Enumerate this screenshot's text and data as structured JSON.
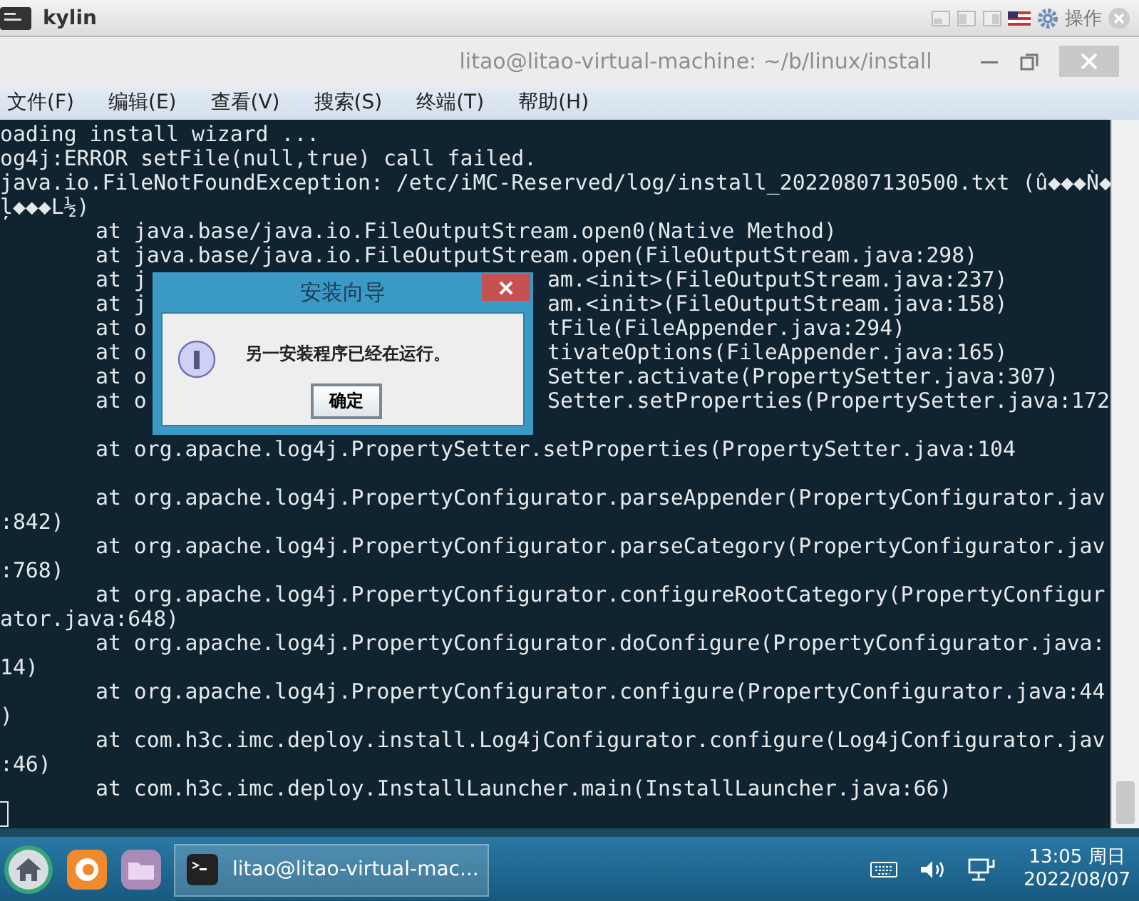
{
  "host_window": {
    "title": "kylin",
    "action_label": "操作"
  },
  "terminal": {
    "title": "litao@litao-virtual-machine: ~/b/linux/install",
    "menu": [
      "文件(F)",
      "编辑(E)",
      "查看(V)",
      "搜索(S)",
      "终端(T)",
      "帮助(H)"
    ],
    "lines": [
      {
        "kind": "plain",
        "text": "oading install wizard ..."
      },
      {
        "kind": "plain",
        "text": "og4j:ERROR setFile(null,true) call failed."
      },
      {
        "kind": "plain",
        "text": "java.io.FileNotFoundException: /etc/iMC-Reserved/log/install_20220807130500.txt (û◆◆◆Ǹ◆"
      },
      {
        "kind": "plain",
        "text": "ļ◆◆◆L½)"
      },
      {
        "kind": "at",
        "text": "at java.base/java.io.FileOutputStream.open0(Native Method)"
      },
      {
        "kind": "at",
        "text": "at java.base/java.io.FileOutputStream.open(FileOutputStream.java:298)"
      },
      {
        "kind": "split",
        "left": "at j",
        "right": "am.<init>(FileOutputStream.java:237)"
      },
      {
        "kind": "split",
        "left": "at j",
        "right": "am.<init>(FileOutputStream.java:158)"
      },
      {
        "kind": "split",
        "left": "at o",
        "right": "tFile(FileAppender.java:294)"
      },
      {
        "kind": "split",
        "left": "at o",
        "right": "tivateOptions(FileAppender.java:165)"
      },
      {
        "kind": "split",
        "left": "at o",
        "right": "Setter.activate(PropertySetter.java:307)"
      },
      {
        "kind": "split",
        "left": "at o",
        "right": "Setter.setProperties(PropertySetter.java:172"
      },
      {
        "kind": "blank"
      },
      {
        "kind": "at",
        "text": "at org.apache.log4j.PropertySetter.setProperties(PropertySetter.java:104"
      },
      {
        "kind": "blank"
      },
      {
        "kind": "at",
        "text": "at org.apache.log4j.PropertyConfigurator.parseAppender(PropertyConfigurator.jav"
      },
      {
        "kind": "plain",
        "text": ":842)"
      },
      {
        "kind": "at",
        "text": "at org.apache.log4j.PropertyConfigurator.parseCategory(PropertyConfigurator.jav"
      },
      {
        "kind": "plain",
        "text": ":768)"
      },
      {
        "kind": "at",
        "text": "at org.apache.log4j.PropertyConfigurator.configureRootCategory(PropertyConfigur"
      },
      {
        "kind": "plain",
        "text": "ator.java:648)"
      },
      {
        "kind": "at",
        "text": "at org.apache.log4j.PropertyConfigurator.doConfigure(PropertyConfigurator.java:"
      },
      {
        "kind": "plain",
        "text": "14)"
      },
      {
        "kind": "at",
        "text": "at org.apache.log4j.PropertyConfigurator.configure(PropertyConfigurator.java:44"
      },
      {
        "kind": "plain",
        "text": ")"
      },
      {
        "kind": "at",
        "text": "at com.h3c.imc.deploy.install.Log4jConfigurator.configure(Log4jConfigurator.jav"
      },
      {
        "kind": "plain",
        "text": ":46)"
      },
      {
        "kind": "at",
        "text": "at com.h3c.imc.deploy.InstallLauncher.main(InstallLauncher.java:66)"
      },
      {
        "kind": "cursor"
      }
    ]
  },
  "dialog": {
    "title": "安装向导",
    "message": "另一安装程序已经在运行。",
    "button": "确定"
  },
  "taskbar": {
    "task": "litao@litao-virtual-mac...",
    "time": "13:05 周日",
    "date": "2022/08/07"
  }
}
